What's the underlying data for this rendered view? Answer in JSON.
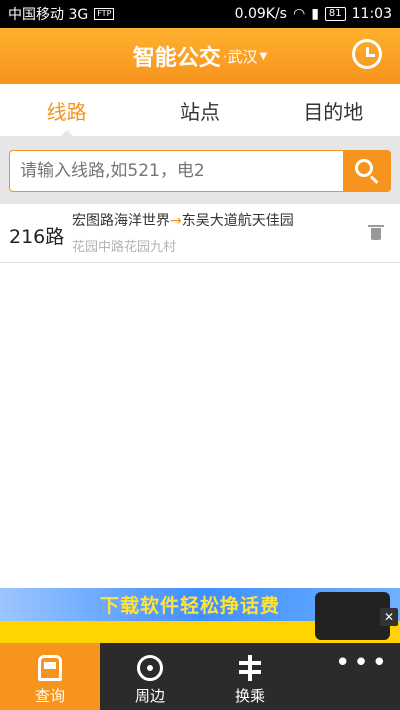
{
  "statusbar": {
    "carrier": "中国移动 3G",
    "ftp": "FTP",
    "speed": "0.09K/s",
    "battery": "81",
    "time": "11:03"
  },
  "header": {
    "title": "智能公交",
    "city": "·武汉"
  },
  "tabs": [
    {
      "label": "线路",
      "active": true
    },
    {
      "label": "站点",
      "active": false
    },
    {
      "label": "目的地",
      "active": false
    }
  ],
  "search": {
    "placeholder": "请输入线路,如521，电2"
  },
  "routes": [
    {
      "number": "216路",
      "from": "宏图路海洋世界",
      "arrow": "→",
      "to": "东吴大道航天佳园",
      "stop": "花园中路花园九村"
    }
  ],
  "ad": {
    "headline": "下载软件轻松挣话费"
  },
  "navbar": [
    {
      "label": "查询",
      "icon": "bus-icon",
      "active": true
    },
    {
      "label": "周边",
      "icon": "location-target-icon",
      "active": false
    },
    {
      "label": "换乘",
      "icon": "signpost-icon",
      "active": false
    },
    {
      "label": "",
      "icon": "more-icon",
      "active": false
    }
  ],
  "colors": {
    "accent": "#f7941d",
    "navbar": "#2b2b2b"
  }
}
